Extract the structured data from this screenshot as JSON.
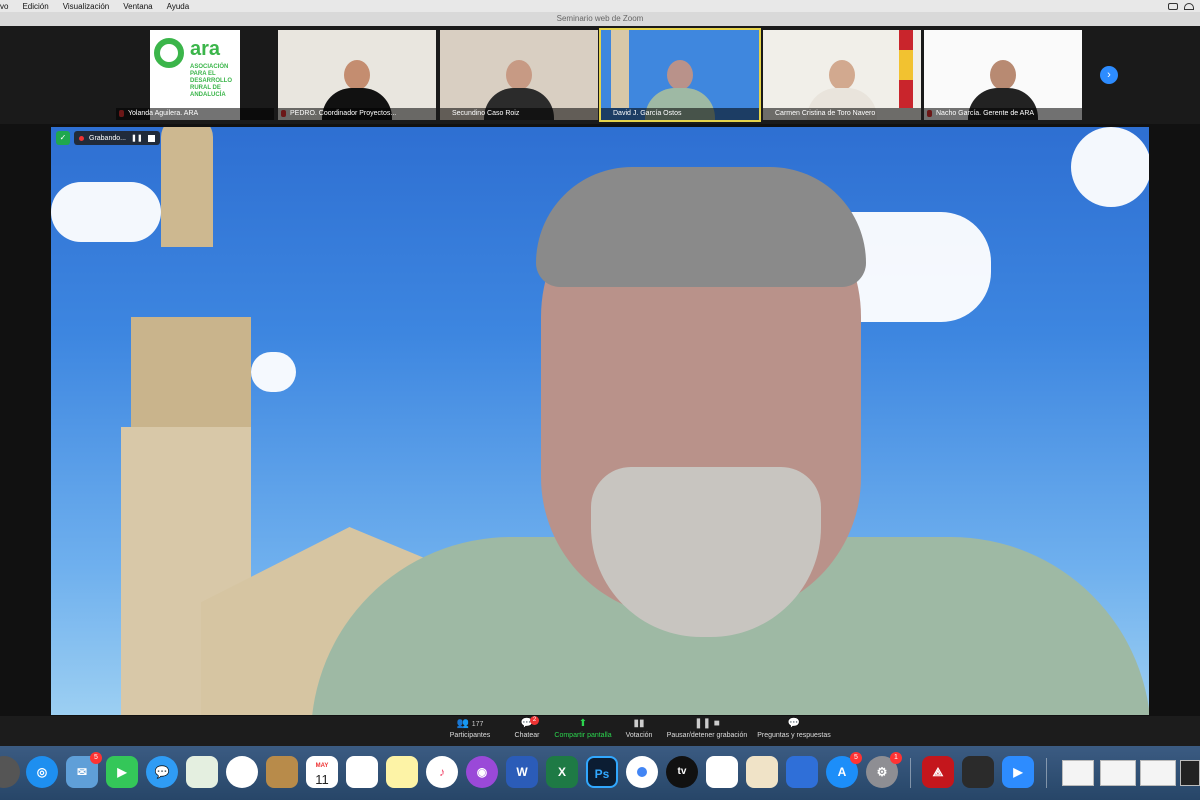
{
  "menubar": {
    "items": [
      "vo",
      "Edición",
      "Visualización",
      "Ventana",
      "Ayuda"
    ]
  },
  "window": {
    "title": "Seminario web de Zoom"
  },
  "participants_strip": [
    {
      "name": "Yolanda Aguilera. ARA",
      "logo_text": "ara",
      "logo_sub": "ASOCIACIÓN PARA EL DESARROLLO RURAL DE ANDALUCÍA",
      "muted": true
    },
    {
      "name": "PEDRO. Coordinador Proyectos...",
      "muted": true
    },
    {
      "name": "Secundino Caso Roiz",
      "muted": false
    },
    {
      "name": "David J. García Ostos",
      "muted": false,
      "active": true
    },
    {
      "name": "Carmen Cristina de Toro Navero",
      "muted": false
    },
    {
      "name": "Nacho García. Gerente de ARA",
      "muted": true
    }
  ],
  "recording": {
    "label": "Grabando..."
  },
  "toolbar": {
    "participants": {
      "label": "Participantes",
      "count": "177"
    },
    "chat": {
      "label": "Chatear",
      "badge": "2"
    },
    "share": {
      "label": "Compartir pantalla"
    },
    "poll": {
      "label": "Votación"
    },
    "record": {
      "label": "Pausar/detener grabación"
    },
    "qa": {
      "label": "Preguntas y respuestas"
    }
  },
  "dock": {
    "calendar_month": "MAY",
    "calendar_day": "11",
    "mail_badge": "5",
    "appstore_badge": "5",
    "settings_badge": "1",
    "word": "W",
    "excel": "X",
    "photoshop": "Ps",
    "appletv": "tv"
  },
  "colors": {
    "zoom_blue": "#2d8cff",
    "share_green": "#2bd44e",
    "active_outline": "#e6d34a",
    "ara_green": "#3bb54a"
  }
}
